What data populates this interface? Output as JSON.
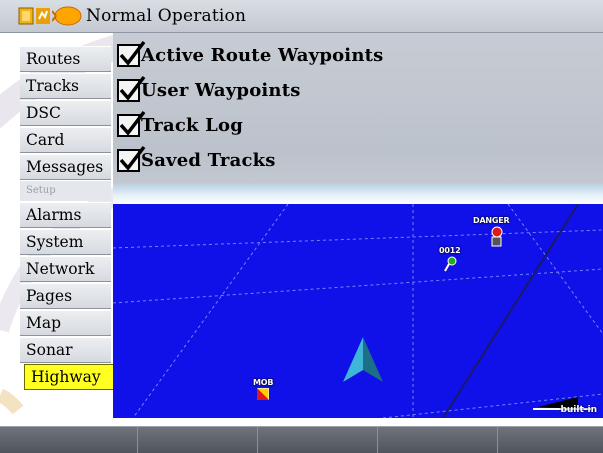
{
  "title": "Normal Operation",
  "menu": {
    "items": [
      {
        "label": "Routes"
      },
      {
        "label": "Tracks"
      },
      {
        "label": "DSC"
      },
      {
        "label": "Card"
      },
      {
        "label": "Messages"
      },
      {
        "label": "Setup",
        "section": true
      },
      {
        "label": "Alarms"
      },
      {
        "label": "System"
      },
      {
        "label": "Network"
      },
      {
        "label": "Pages"
      },
      {
        "label": "Map"
      },
      {
        "label": "Sonar"
      },
      {
        "label": "Highway",
        "selected": true
      }
    ]
  },
  "options": [
    {
      "label": "Active Route Waypoints",
      "checked": true
    },
    {
      "label": "User Waypoints",
      "checked": true
    },
    {
      "label": "Track Log",
      "checked": true
    },
    {
      "label": "Saved Tracks",
      "checked": true
    }
  ],
  "map": {
    "waypoints": {
      "danger": "DANGER",
      "user": "0012",
      "mob": "MOB"
    },
    "scale_label": "built-in"
  },
  "colors": {
    "water": "#1010e8",
    "selected": "#ffff22",
    "vessel": "#2aa6c9"
  },
  "icons": [
    "gps-icon",
    "signal-icon",
    "sun-icon",
    "checkmark-icon",
    "vessel-icon",
    "waypoint-flag-icon",
    "mob-icon"
  ],
  "softkeys": [
    "",
    "",
    "",
    "",
    ""
  ]
}
